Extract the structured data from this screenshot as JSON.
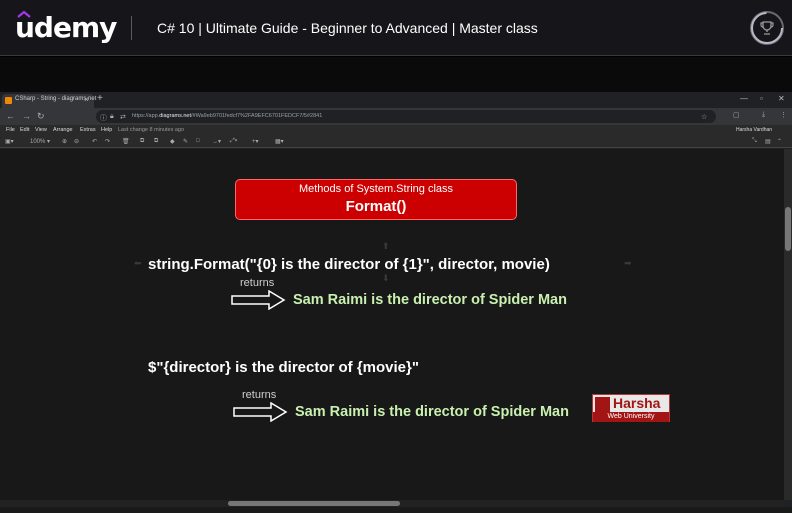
{
  "header": {
    "logo_text": "udemy",
    "course_title": "C# 10 | Ultimate Guide - Beginner to Advanced | Master class",
    "trophy_icon": "trophy-icon"
  },
  "browser": {
    "tab_title": "CSharp - String - diagrams.net",
    "tab_close": "×",
    "tab_new": "+",
    "window_controls": [
      "—",
      "▫",
      "✕"
    ],
    "url_prefix": "https://app.",
    "url_domain": "diagrams.net",
    "url_path": "/#Wa9eb9701fedcf7%2FA9EFC6701FEDCF7/5#2841",
    "menu": [
      "File",
      "Edit",
      "View",
      "Arrange",
      "Extras",
      "Help"
    ],
    "last_change": "Last change 8 minutes ago",
    "user": "Harsha Vardhan",
    "zoom": "100%"
  },
  "diagram": {
    "title_sub": "Methods of System.String class",
    "title_main": "Format()",
    "example1_code": "string.Format(\"{0} is the director of {1}\", director, movie)",
    "example1_returns": "returns",
    "example1_result": "Sam Raimi is the director of Spider Man",
    "example2_code": "$\"{director} is the director of {movie}\"",
    "example2_returns": "returns",
    "example2_result": "Sam Raimi is the director of Spider Man"
  },
  "watermark": {
    "name": "Harsha",
    "subtitle": "Web University"
  },
  "colors": {
    "title_box": "#cc0000",
    "result_text": "#c9f0b0",
    "canvas_bg": "#181818"
  }
}
